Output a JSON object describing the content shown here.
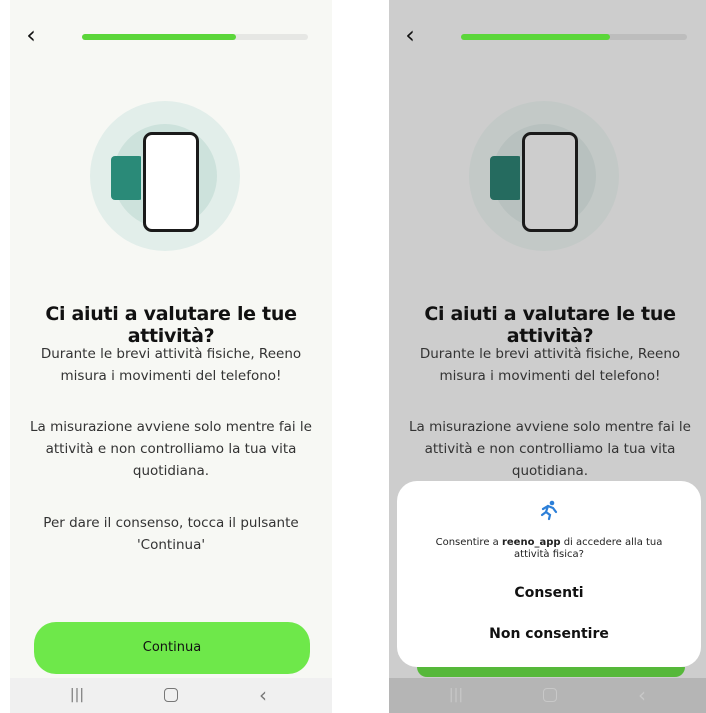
{
  "colors": {
    "accent": "#6ee84a",
    "progress": "#5bd63a",
    "teal": "#2a8a78",
    "dialog_icon": "#2c7fd8"
  },
  "left": {
    "back_icon": "‹",
    "progress": 0.68,
    "title": "Ci aiuti a valutare le tue attività?",
    "para1": "Durante le brevi attività fisiche, Reeno misura i movimenti del telefono!",
    "para2": "La misurazione avviene solo mentre fai le attività e non controlliamo la tua vita quotidiana.",
    "para3": "Per dare il consenso, tocca il pulsante 'Continua'",
    "continue_label": "Continua",
    "nav": {
      "recent": "|||",
      "home": "",
      "back": "‹"
    }
  },
  "right": {
    "back_icon": "‹",
    "progress": 0.66,
    "title": "Ci aiuti a valutare le tue attività?",
    "para1": "Durante le brevi attività fisiche, Reeno misura i movimenti del telefono!",
    "para2": "La misurazione avviene solo mentre fai le attività e non controlliamo la tua vita quotidiana.",
    "dialog": {
      "icon": "running-person-icon",
      "message_prefix": "Consentire a ",
      "app_name": "reeno_app",
      "message_suffix": " di accedere alla tua attività fisica?",
      "allow": "Consenti",
      "deny": "Non consentire"
    },
    "nav": {
      "recent": "|||",
      "home": "",
      "back": "‹"
    }
  }
}
